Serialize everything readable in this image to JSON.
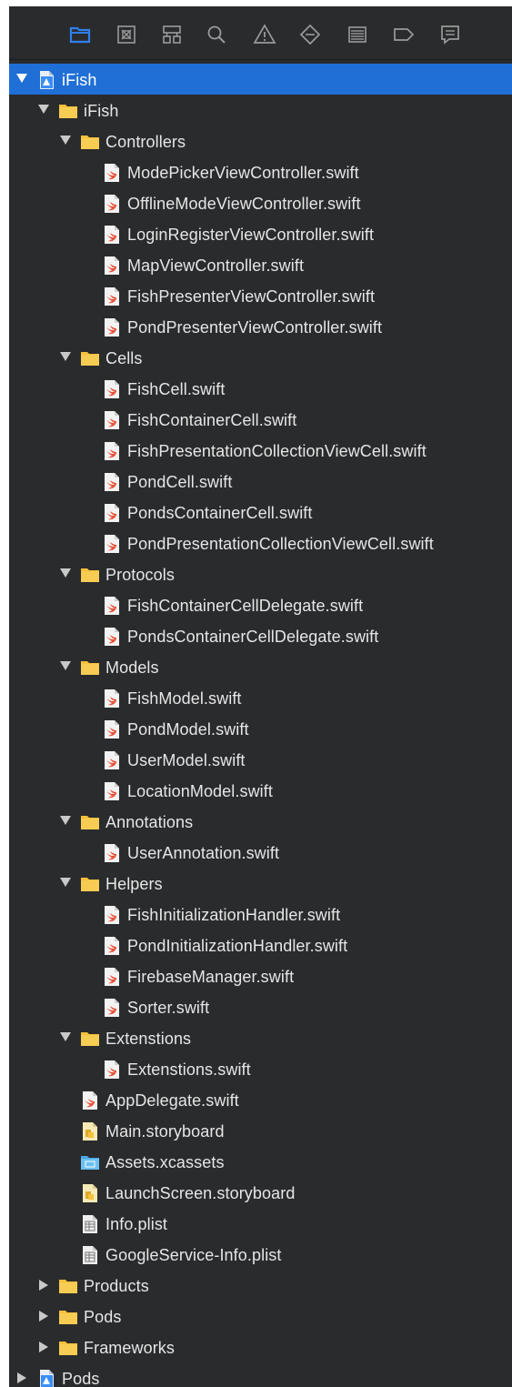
{
  "toolbar": {
    "icons": [
      {
        "name": "project-navigator-icon",
        "active": true
      },
      {
        "name": "source-control-navigator-icon",
        "active": false
      },
      {
        "name": "symbol-navigator-icon",
        "active": false
      },
      {
        "name": "find-navigator-icon",
        "active": false
      },
      {
        "name": "issue-navigator-icon",
        "active": false
      },
      {
        "name": "test-navigator-icon",
        "active": false
      },
      {
        "name": "debug-navigator-icon",
        "active": false
      },
      {
        "name": "breakpoint-navigator-icon",
        "active": false
      },
      {
        "name": "report-navigator-icon",
        "active": false
      }
    ],
    "active_color": "#2f80ed",
    "inactive_color": "#9a9a9a"
  },
  "tree": [
    {
      "label": "iFish",
      "type": "project",
      "depth": 0,
      "disclosure": "open",
      "selected": true
    },
    {
      "label": "iFish",
      "type": "folder",
      "depth": 1,
      "disclosure": "open"
    },
    {
      "label": "Controllers",
      "type": "folder",
      "depth": 2,
      "disclosure": "open"
    },
    {
      "label": "ModePickerViewController.swift",
      "type": "swift",
      "depth": 3
    },
    {
      "label": "OfflineModeViewController.swift",
      "type": "swift",
      "depth": 3
    },
    {
      "label": "LoginRegisterViewController.swift",
      "type": "swift",
      "depth": 3
    },
    {
      "label": "MapViewController.swift",
      "type": "swift",
      "depth": 3
    },
    {
      "label": "FishPresenterViewController.swift",
      "type": "swift",
      "depth": 3
    },
    {
      "label": "PondPresenterViewController.swift",
      "type": "swift",
      "depth": 3
    },
    {
      "label": "Cells",
      "type": "folder",
      "depth": 2,
      "disclosure": "open"
    },
    {
      "label": "FishCell.swift",
      "type": "swift",
      "depth": 3
    },
    {
      "label": "FishContainerCell.swift",
      "type": "swift",
      "depth": 3
    },
    {
      "label": "FishPresentationCollectionViewCell.swift",
      "type": "swift",
      "depth": 3
    },
    {
      "label": "PondCell.swift",
      "type": "swift",
      "depth": 3
    },
    {
      "label": "PondsContainerCell.swift",
      "type": "swift",
      "depth": 3
    },
    {
      "label": "PondPresentationCollectionViewCell.swift",
      "type": "swift",
      "depth": 3
    },
    {
      "label": "Protocols",
      "type": "folder",
      "depth": 2,
      "disclosure": "open"
    },
    {
      "label": "FishContainerCellDelegate.swift",
      "type": "swift",
      "depth": 3
    },
    {
      "label": "PondsContainerCellDelegate.swift",
      "type": "swift",
      "depth": 3
    },
    {
      "label": "Models",
      "type": "folder",
      "depth": 2,
      "disclosure": "open"
    },
    {
      "label": "FishModel.swift",
      "type": "swift",
      "depth": 3
    },
    {
      "label": "PondModel.swift",
      "type": "swift",
      "depth": 3
    },
    {
      "label": "UserModel.swift",
      "type": "swift",
      "depth": 3
    },
    {
      "label": "LocationModel.swift",
      "type": "swift",
      "depth": 3
    },
    {
      "label": "Annotations",
      "type": "folder",
      "depth": 2,
      "disclosure": "open"
    },
    {
      "label": "UserAnnotation.swift",
      "type": "swift",
      "depth": 3
    },
    {
      "label": "Helpers",
      "type": "folder",
      "depth": 2,
      "disclosure": "open"
    },
    {
      "label": "FishInitializationHandler.swift",
      "type": "swift",
      "depth": 3
    },
    {
      "label": "PondInitializationHandler.swift",
      "type": "swift",
      "depth": 3
    },
    {
      "label": "FirebaseManager.swift",
      "type": "swift",
      "depth": 3
    },
    {
      "label": "Sorter.swift",
      "type": "swift",
      "depth": 3
    },
    {
      "label": "Extenstions",
      "type": "folder",
      "depth": 2,
      "disclosure": "open"
    },
    {
      "label": "Extenstions.swift",
      "type": "swift",
      "depth": 3
    },
    {
      "label": "AppDelegate.swift",
      "type": "swift",
      "depth": 2
    },
    {
      "label": "Main.storyboard",
      "type": "storyboard",
      "depth": 2
    },
    {
      "label": "Assets.xcassets",
      "type": "assets",
      "depth": 2
    },
    {
      "label": "LaunchScreen.storyboard",
      "type": "storyboard",
      "depth": 2
    },
    {
      "label": "Info.plist",
      "type": "plist",
      "depth": 2
    },
    {
      "label": "GoogleService-Info.plist",
      "type": "plist",
      "depth": 2
    },
    {
      "label": "Products",
      "type": "folder",
      "depth": 1,
      "disclosure": "closed"
    },
    {
      "label": "Pods",
      "type": "folder",
      "depth": 1,
      "disclosure": "closed"
    },
    {
      "label": "Frameworks",
      "type": "folder",
      "depth": 1,
      "disclosure": "closed"
    },
    {
      "label": "Pods",
      "type": "project",
      "depth": 0,
      "disclosure": "closed"
    }
  ],
  "colors": {
    "background": "#2a2b2d",
    "selection": "#1f6fd6",
    "folder": "#f5c13a",
    "swift": "#e8533b",
    "text": "#e6e6e6"
  }
}
